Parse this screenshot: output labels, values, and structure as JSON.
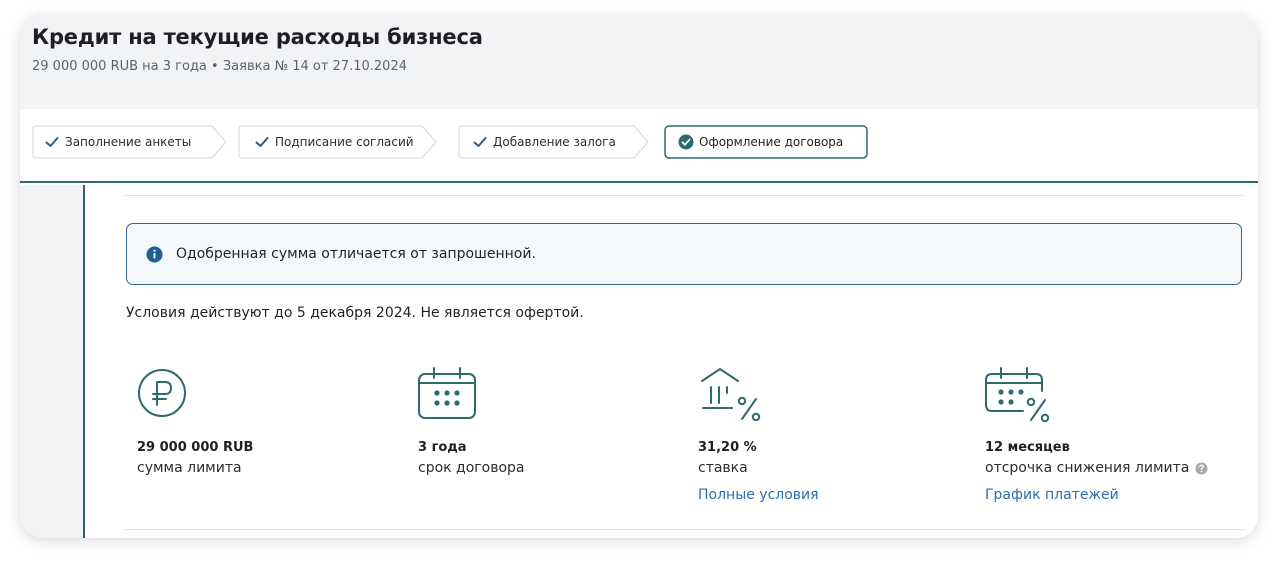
{
  "header": {
    "title": "Кредит на текущие расходы бизнеса",
    "subtitle": "29 000 000 RUB на 3 года • Заявка № 14 от 27.10.2024"
  },
  "steps": [
    {
      "label": "Заполнение анкеты",
      "status": "done"
    },
    {
      "label": "Подписание согласий",
      "status": "done"
    },
    {
      "label": "Добавление залога",
      "status": "done"
    },
    {
      "label": "Оформление договора",
      "status": "active"
    }
  ],
  "notice": {
    "icon": "info-icon",
    "text": "Одобренная сумма отличается от запрошенной."
  },
  "terms_note": "Условия действуют до 5 декабря 2024. Не является офертой.",
  "conditions": [
    {
      "icon": "ruble-icon",
      "value": "29 000 000 RUB",
      "label": "сумма лимита"
    },
    {
      "icon": "calendar-icon",
      "value": "3 года",
      "label": "срок договора"
    },
    {
      "icon": "bank-percent-icon",
      "value": "31,20 %",
      "label": "ставка",
      "link": "Полные условия"
    },
    {
      "icon": "calendar-percent-icon",
      "value": "12 месяцев",
      "label": "отсрочка снижения лимита",
      "link": "График платежей"
    }
  ],
  "colors": {
    "accent": "#2e6b6b",
    "link": "#2a6fb0",
    "check": "#2b5d86",
    "icon_stroke": "#2f6b6b"
  }
}
